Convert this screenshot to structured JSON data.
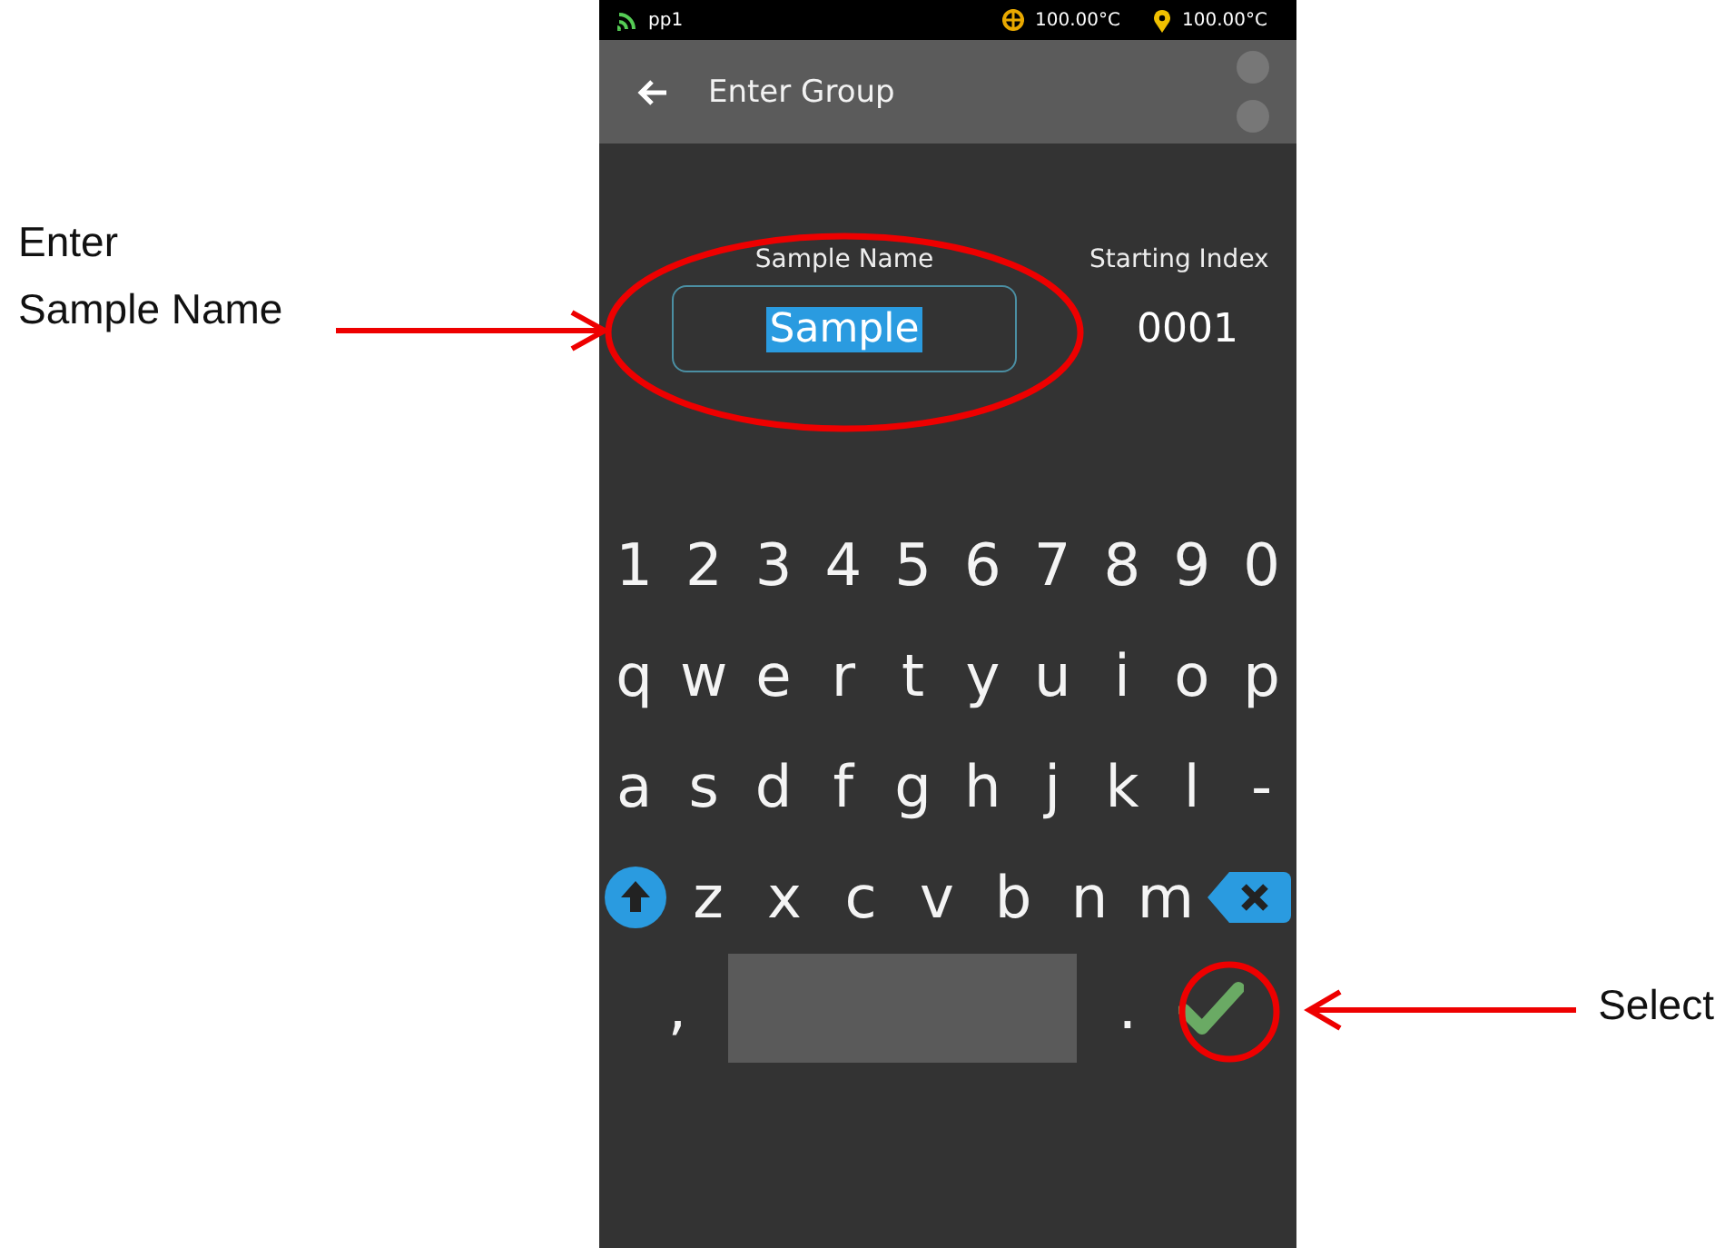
{
  "annotations": {
    "left": [
      "Enter",
      "Sample Name"
    ],
    "right": "Select"
  },
  "status_bar": {
    "network": "pp1",
    "readings": [
      "100.00°C",
      "100.00°C"
    ]
  },
  "header": {
    "title": "Enter Group"
  },
  "form": {
    "name_label": "Sample Name",
    "name_value": "Sample",
    "index_label": "Starting Index",
    "index_value": "0001"
  },
  "keyboard": [
    [
      {
        "kind": "char",
        "label": "1"
      },
      {
        "kind": "char",
        "label": "2"
      },
      {
        "kind": "char",
        "label": "3"
      },
      {
        "kind": "char",
        "label": "4"
      },
      {
        "kind": "char",
        "label": "5"
      },
      {
        "kind": "char",
        "label": "6"
      },
      {
        "kind": "char",
        "label": "7"
      },
      {
        "kind": "char",
        "label": "8"
      },
      {
        "kind": "char",
        "label": "9"
      },
      {
        "kind": "char",
        "label": "0"
      }
    ],
    [
      {
        "kind": "char",
        "label": "q"
      },
      {
        "kind": "char",
        "label": "w"
      },
      {
        "kind": "char",
        "label": "e"
      },
      {
        "kind": "char",
        "label": "r"
      },
      {
        "kind": "char",
        "label": "t"
      },
      {
        "kind": "char",
        "label": "y"
      },
      {
        "kind": "char",
        "label": "u"
      },
      {
        "kind": "char",
        "label": "i"
      },
      {
        "kind": "char",
        "label": "o"
      },
      {
        "kind": "char",
        "label": "p"
      }
    ],
    [
      {
        "kind": "char",
        "label": "a"
      },
      {
        "kind": "char",
        "label": "s"
      },
      {
        "kind": "char",
        "label": "d"
      },
      {
        "kind": "char",
        "label": "f"
      },
      {
        "kind": "char",
        "label": "g"
      },
      {
        "kind": "char",
        "label": "h"
      },
      {
        "kind": "char",
        "label": "j"
      },
      {
        "kind": "char",
        "label": "k"
      },
      {
        "kind": "char",
        "label": "l"
      },
      {
        "kind": "char",
        "label": "-"
      }
    ],
    [
      {
        "kind": "shift"
      },
      {
        "kind": "char",
        "label": "z"
      },
      {
        "kind": "char",
        "label": "x"
      },
      {
        "kind": "char",
        "label": "c"
      },
      {
        "kind": "char",
        "label": "v"
      },
      {
        "kind": "char",
        "label": "b"
      },
      {
        "kind": "char",
        "label": "n"
      },
      {
        "kind": "char",
        "label": "m"
      },
      {
        "kind": "backspace"
      }
    ],
    [
      {
        "kind": "char",
        "label": ","
      },
      {
        "kind": "space"
      },
      {
        "kind": "char",
        "label": "."
      },
      {
        "kind": "enter"
      }
    ]
  ]
}
